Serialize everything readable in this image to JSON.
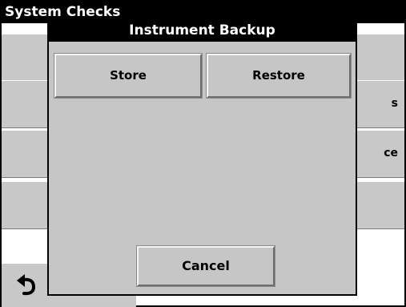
{
  "screen": {
    "title": "System Checks",
    "rows": [
      {
        "left": "",
        "right": ""
      },
      {
        "left": "(",
        "right": "s"
      },
      {
        "left": "",
        "right": "ce"
      },
      {
        "left": "",
        "right": ""
      }
    ]
  },
  "dialog": {
    "title": "Instrument Backup",
    "store_label": "Store",
    "restore_label": "Restore",
    "cancel_label": "Cancel"
  },
  "icons": {
    "back": "back-arrow-icon"
  }
}
